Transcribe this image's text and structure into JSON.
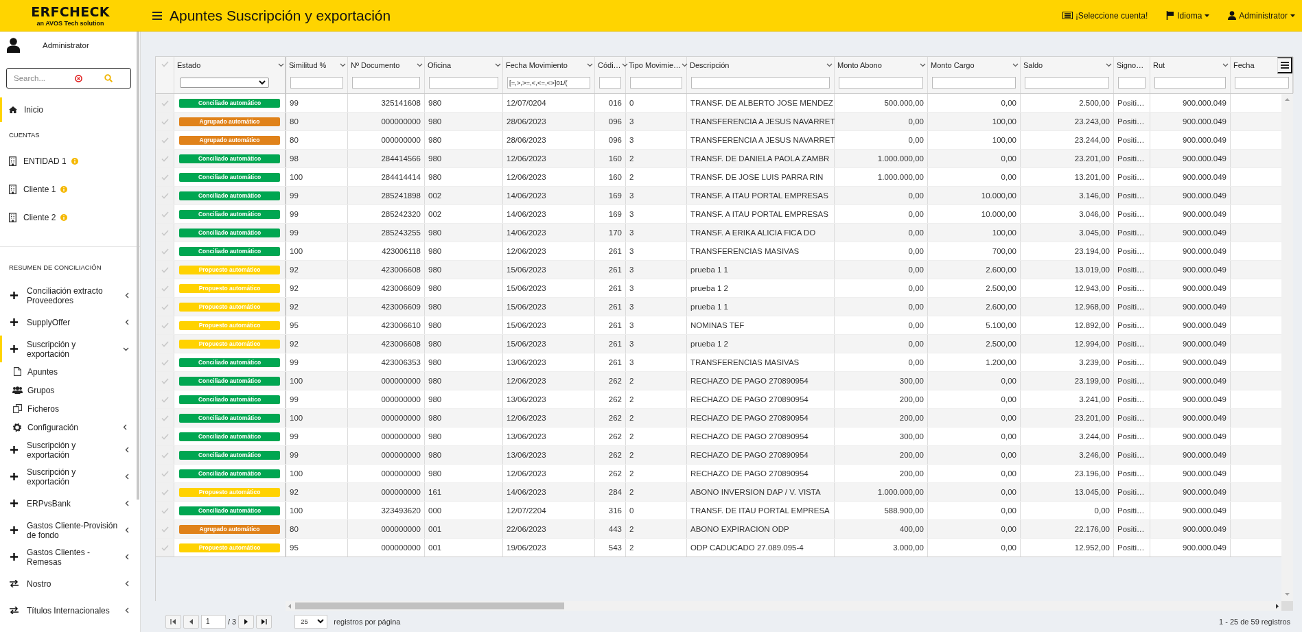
{
  "header": {
    "brand": "ERFCHECK",
    "tagline": "an AVOS Tech solution",
    "title": "Apuntes Suscripción y exportación",
    "links": [
      {
        "kind": "account",
        "label": "¡Seleccione cuenta!",
        "dropdown": false
      },
      {
        "kind": "language",
        "label": "Idioma",
        "dropdown": true
      },
      {
        "kind": "user",
        "label": "Administrator",
        "dropdown": true
      }
    ]
  },
  "sidebar": {
    "user": "Administrator",
    "search": {
      "placeholder": "Search..."
    },
    "items": [
      {
        "kind": "link",
        "label": "Inicio",
        "selected": true
      },
      {
        "kind": "heading",
        "label": "CUENTAS"
      },
      {
        "kind": "account",
        "label": "ENTIDAD 1",
        "selected": false
      },
      {
        "kind": "account",
        "label": "Cliente 1",
        "selected": false
      },
      {
        "kind": "account",
        "label": "Cliente 2",
        "selected": false
      },
      {
        "kind": "heading",
        "label": "RESUMEN DE CONCILIACIÓN"
      },
      {
        "kind": "group",
        "label": "Conciliación extracto Proveedores",
        "selected": false,
        "expanded": false
      },
      {
        "kind": "group",
        "label": "SupplyOffer",
        "selected": false,
        "expanded": false
      },
      {
        "kind": "group",
        "label": "Suscripción y exportación",
        "selected": true,
        "expanded": true,
        "children": [
          {
            "kind": "file",
            "label": "Apuntes",
            "submenu": false
          },
          {
            "kind": "users",
            "label": "Grupos",
            "submenu": false
          },
          {
            "kind": "files",
            "label": "Ficheros",
            "submenu": false
          },
          {
            "kind": "settings",
            "label": "Configuración",
            "submenu": true
          }
        ]
      },
      {
        "kind": "group",
        "label": "Suscripción y exportación",
        "selected": false,
        "expanded": false
      },
      {
        "kind": "group",
        "label": "Suscripción y exportación",
        "selected": false,
        "expanded": false
      },
      {
        "kind": "group",
        "label": "ERPvsBank",
        "selected": false,
        "expanded": false
      },
      {
        "kind": "group",
        "label": "Gastos Cliente-Provisión de fondo",
        "selected": false,
        "expanded": false
      },
      {
        "kind": "group",
        "label": "Gastos Clientes - Remesas",
        "selected": false,
        "expanded": false
      },
      {
        "kind": "transfer",
        "label": "Nostro",
        "selected": false,
        "expanded": false
      },
      {
        "kind": "transfer",
        "label": "Títulos Internacionales",
        "selected": false,
        "expanded": false
      }
    ]
  },
  "table": {
    "all_selected": false,
    "status_column": {
      "label": "Estado",
      "filter": {
        "kind": "select"
      },
      "sort_icon": true
    },
    "columns": [
      {
        "label": "Similitud %",
        "filter": {
          "kind": "text"
        },
        "sort_icon": true
      },
      {
        "label": "Nº Documento",
        "filter": {
          "kind": "text"
        },
        "sort_icon": true
      },
      {
        "label": "Oficina",
        "filter": {
          "kind": "text"
        },
        "sort_icon": true
      },
      {
        "label": "Fecha Movimiento",
        "filter": {
          "kind": "text",
          "placeholder": "[=,>,>=,<,<=,<>]01/("
        },
        "sort_icon": true
      },
      {
        "label": "Códi…",
        "filter": {
          "kind": "text"
        },
        "sort_icon": true
      },
      {
        "label": "Tipo Movimie…",
        "filter": {
          "kind": "text"
        },
        "sort_icon": true
      },
      {
        "label": "Descripción",
        "filter": {
          "kind": "text"
        },
        "sort_icon": true
      },
      {
        "label": "Monto Abono",
        "filter": {
          "kind": "text"
        },
        "sort_icon": true
      },
      {
        "label": "Monto Cargo",
        "filter": {
          "kind": "text"
        },
        "sort_icon": true
      },
      {
        "label": "Saldo",
        "filter": {
          "kind": "text"
        },
        "sort_icon": true
      },
      {
        "label": "Signo…",
        "filter": {
          "kind": "text"
        },
        "sort_icon": false
      },
      {
        "label": "Rut",
        "filter": {
          "kind": "text"
        },
        "sort_icon": true
      },
      {
        "label": "Fecha",
        "filter": {
          "kind": "text"
        },
        "sort_icon": false
      }
    ],
    "rows": [
      {
        "selected": false,
        "estado": {
          "label": "Conciliado automático",
          "color": "#00a651"
        },
        "cells": [
          "99",
          "325141608",
          "980",
          "12/07/0204",
          "016",
          "0",
          "TRANSF. DE ALBERTO JOSE MENDEZ",
          "500.000,00",
          "0,00",
          "2.500,00",
          "Positi…",
          "900.000.049"
        ]
      },
      {
        "selected": false,
        "estado": {
          "label": "Agrupado automático",
          "color": "#e0821a"
        },
        "cells": [
          "80",
          "000000000",
          "980",
          "28/06/2023",
          "096",
          "3",
          "TRANSFERENCIA A JESUS NAVARRET",
          "0,00",
          "100,00",
          "23.243,00",
          "Positi…",
          "900.000.049"
        ]
      },
      {
        "selected": false,
        "estado": {
          "label": "Agrupado automático",
          "color": "#e0821a"
        },
        "cells": [
          "80",
          "000000000",
          "980",
          "28/06/2023",
          "096",
          "3",
          "TRANSFERENCIA A JESUS NAVARRET",
          "0,00",
          "100,00",
          "23.244,00",
          "Positi…",
          "900.000.049"
        ]
      },
      {
        "selected": false,
        "estado": {
          "label": "Conciliado automático",
          "color": "#00a651"
        },
        "cells": [
          "98",
          "284414566",
          "980",
          "12/06/2023",
          "160",
          "2",
          "TRANSF. DE DANIELA PAOLA ZAMBR",
          "1.000.000,00",
          "0,00",
          "23.201,00",
          "Positi…",
          "900.000.049"
        ]
      },
      {
        "selected": false,
        "estado": {
          "label": "Conciliado automático",
          "color": "#00a651"
        },
        "cells": [
          "100",
          "284414414",
          "980",
          "12/06/2023",
          "160",
          "2",
          "TRANSF. DE JOSE LUIS PARRA RIN",
          "1.000.000,00",
          "0,00",
          "13.201,00",
          "Positi…",
          "900.000.049"
        ]
      },
      {
        "selected": false,
        "estado": {
          "label": "Conciliado automático",
          "color": "#00a651"
        },
        "cells": [
          "99",
          "285241898",
          "002",
          "14/06/2023",
          "169",
          "3",
          "TRANSF. A ITAU PORTAL EMPRESAS",
          "0,00",
          "10.000,00",
          "3.146,00",
          "Positi…",
          "900.000.049"
        ]
      },
      {
        "selected": false,
        "estado": {
          "label": "Conciliado automático",
          "color": "#00a651"
        },
        "cells": [
          "99",
          "285242320",
          "002",
          "14/06/2023",
          "169",
          "3",
          "TRANSF. A ITAU PORTAL EMPRESAS",
          "0,00",
          "10.000,00",
          "3.046,00",
          "Positi…",
          "900.000.049"
        ]
      },
      {
        "selected": false,
        "estado": {
          "label": "Conciliado automático",
          "color": "#00a651"
        },
        "cells": [
          "99",
          "285243255",
          "980",
          "14/06/2023",
          "170",
          "3",
          "TRANSF. A ERIKA ALICIA FICA DO",
          "0,00",
          "100,00",
          "3.045,00",
          "Positi…",
          "900.000.049"
        ]
      },
      {
        "selected": false,
        "estado": {
          "label": "Conciliado automático",
          "color": "#00a651"
        },
        "cells": [
          "100",
          "423006118",
          "980",
          "12/06/2023",
          "261",
          "3",
          "TRANSFERENCIAS MASIVAS",
          "0,00",
          "700,00",
          "23.194,00",
          "Positi…",
          "900.000.049"
        ]
      },
      {
        "selected": false,
        "estado": {
          "label": "Propuesto automático",
          "color": "#ffd200"
        },
        "cells": [
          "92",
          "423006608",
          "980",
          "15/06/2023",
          "261",
          "3",
          "prueba 1 1",
          "0,00",
          "2.600,00",
          "13.019,00",
          "Positi…",
          "900.000.049"
        ]
      },
      {
        "selected": false,
        "estado": {
          "label": "Propuesto automático",
          "color": "#ffd200"
        },
        "cells": [
          "92",
          "423006609",
          "980",
          "15/06/2023",
          "261",
          "3",
          "prueba 1 2",
          "0,00",
          "2.500,00",
          "12.943,00",
          "Positi…",
          "900.000.049"
        ]
      },
      {
        "selected": false,
        "estado": {
          "label": "Propuesto automático",
          "color": "#ffd200"
        },
        "cells": [
          "92",
          "423006609",
          "980",
          "15/06/2023",
          "261",
          "3",
          "prueba 1 1",
          "0,00",
          "2.600,00",
          "12.968,00",
          "Positi…",
          "900.000.049"
        ]
      },
      {
        "selected": false,
        "estado": {
          "label": "Propuesto automático",
          "color": "#ffd200"
        },
        "cells": [
          "95",
          "423006610",
          "980",
          "15/06/2023",
          "261",
          "3",
          "NOMINAS TEF",
          "0,00",
          "5.100,00",
          "12.892,00",
          "Positi…",
          "900.000.049"
        ]
      },
      {
        "selected": false,
        "estado": {
          "label": "Propuesto automático",
          "color": "#ffd200"
        },
        "cells": [
          "92",
          "423006608",
          "980",
          "15/06/2023",
          "261",
          "3",
          "prueba 1 2",
          "0,00",
          "2.500,00",
          "12.994,00",
          "Positi…",
          "900.000.049"
        ]
      },
      {
        "selected": false,
        "estado": {
          "label": "Conciliado automático",
          "color": "#00a651"
        },
        "cells": [
          "99",
          "423006353",
          "980",
          "13/06/2023",
          "261",
          "3",
          "TRANSFERENCIAS MASIVAS",
          "0,00",
          "1.200,00",
          "3.239,00",
          "Positi…",
          "900.000.049"
        ]
      },
      {
        "selected": false,
        "estado": {
          "label": "Conciliado automático",
          "color": "#00a651"
        },
        "cells": [
          "100",
          "000000000",
          "980",
          "12/06/2023",
          "262",
          "2",
          "RECHAZO DE PAGO 270890954",
          "300,00",
          "0,00",
          "23.199,00",
          "Positi…",
          "900.000.049"
        ]
      },
      {
        "selected": false,
        "estado": {
          "label": "Conciliado automático",
          "color": "#00a651"
        },
        "cells": [
          "99",
          "000000000",
          "980",
          "13/06/2023",
          "262",
          "2",
          "RECHAZO DE PAGO 270890954",
          "200,00",
          "0,00",
          "3.241,00",
          "Positi…",
          "900.000.049"
        ]
      },
      {
        "selected": false,
        "estado": {
          "label": "Conciliado automático",
          "color": "#00a651"
        },
        "cells": [
          "100",
          "000000000",
          "980",
          "12/06/2023",
          "262",
          "2",
          "RECHAZO DE PAGO 270890954",
          "200,00",
          "0,00",
          "23.201,00",
          "Positi…",
          "900.000.049"
        ]
      },
      {
        "selected": false,
        "estado": {
          "label": "Conciliado automático",
          "color": "#00a651"
        },
        "cells": [
          "99",
          "000000000",
          "980",
          "13/06/2023",
          "262",
          "2",
          "RECHAZO DE PAGO 270890954",
          "300,00",
          "0,00",
          "3.244,00",
          "Positi…",
          "900.000.049"
        ]
      },
      {
        "selected": false,
        "estado": {
          "label": "Conciliado automático",
          "color": "#00a651"
        },
        "cells": [
          "99",
          "000000000",
          "980",
          "13/06/2023",
          "262",
          "2",
          "RECHAZO DE PAGO 270890954",
          "200,00",
          "0,00",
          "3.246,00",
          "Positi…",
          "900.000.049"
        ]
      },
      {
        "selected": false,
        "estado": {
          "label": "Conciliado automático",
          "color": "#00a651"
        },
        "cells": [
          "100",
          "000000000",
          "980",
          "12/06/2023",
          "262",
          "2",
          "RECHAZO DE PAGO 270890954",
          "200,00",
          "0,00",
          "23.196,00",
          "Positi…",
          "900.000.049"
        ]
      },
      {
        "selected": false,
        "estado": {
          "label": "Propuesto automático",
          "color": "#ffd200"
        },
        "cells": [
          "92",
          "000000000",
          "161",
          "14/06/2023",
          "284",
          "2",
          "ABONO INVERSION DAP / V. VISTA",
          "1.000.000,00",
          "0,00",
          "13.045,00",
          "Positi…",
          "900.000.049"
        ]
      },
      {
        "selected": false,
        "estado": {
          "label": "Conciliado automático",
          "color": "#00a651"
        },
        "cells": [
          "100",
          "323493620",
          "000",
          "12/07/2204",
          "316",
          "0",
          "TRANSF. DE ITAU PORTAL EMPRESA",
          "588.900,00",
          "0,00",
          "0,00",
          "Positi…",
          "900.000.049"
        ]
      },
      {
        "selected": false,
        "estado": {
          "label": "Agrupado automático",
          "color": "#e0821a"
        },
        "cells": [
          "80",
          "000000000",
          "001",
          "22/06/2023",
          "443",
          "2",
          "ABONO EXPIRACION ODP",
          "400,00",
          "0,00",
          "22.176,00",
          "Positi…",
          "900.000.049"
        ]
      },
      {
        "selected": false,
        "estado": {
          "label": "Propuesto automático",
          "color": "#ffd200"
        },
        "cells": [
          "95",
          "000000000",
          "001",
          "19/06/2023",
          "543",
          "2",
          "ODP CADUCADO 27.089.095-4",
          "3.000,00",
          "0,00",
          "12.952,00",
          "Positi…",
          "900.000.049"
        ]
      }
    ]
  },
  "pager": {
    "page": "1",
    "pages": "/ 3",
    "page_size": "25",
    "page_size_label": "registros por página",
    "summary": "1 - 25 de 59 registros"
  }
}
